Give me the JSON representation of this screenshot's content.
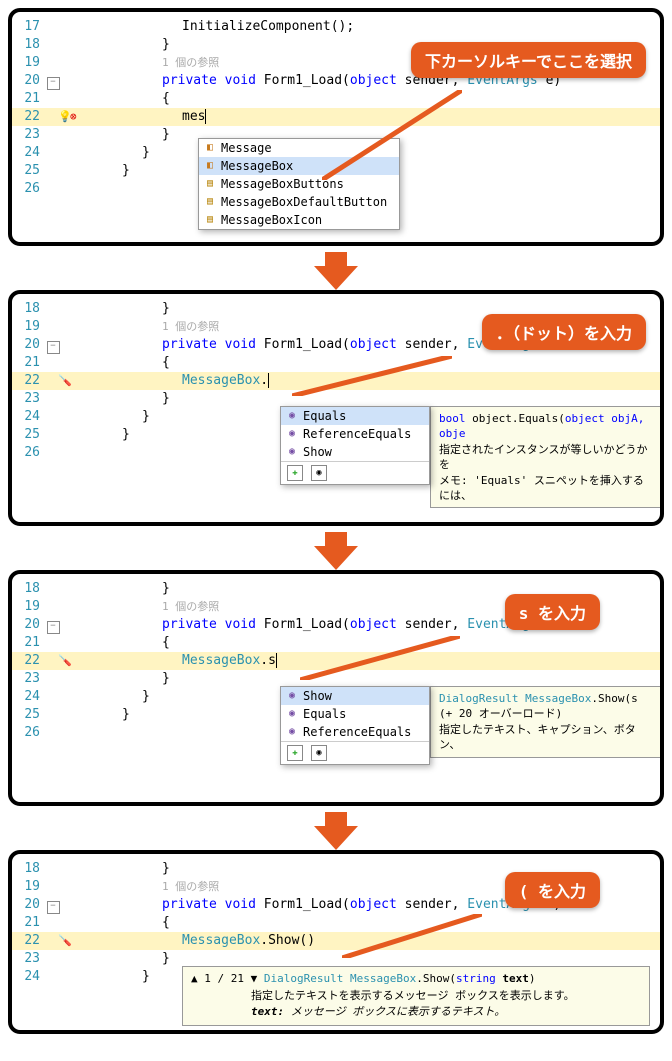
{
  "callouts": {
    "c1": "下カーソルキーでここを選択",
    "c2": "．（ドット）を入力",
    "c3": "s を入力",
    "c4": "( を入力"
  },
  "lines": [
    "17",
    "18",
    "19",
    "20",
    "21",
    "22",
    "23",
    "24",
    "25",
    "26"
  ],
  "ref_hint": "1 個の参照",
  "sig_private": "private",
  "sig_void": "void",
  "sig_name": "Form1_Load",
  "sig_obj": "object",
  "sig_sender": "sender",
  "sig_evargs": "EventArgs",
  "sig_e": "e",
  "brace_open": "{",
  "brace_close": "}",
  "init_call": "InitializeComponent();",
  "panel1": {
    "typed": "mes",
    "items": [
      "Message",
      "MessageBox",
      "MessageBoxButtons",
      "MessageBoxDefaultButton",
      "MessageBoxIcon"
    ]
  },
  "panel2": {
    "typed_class": "MessageBox",
    "typed_after": ".",
    "items": [
      "Equals",
      "ReferenceEquals",
      "Show"
    ],
    "tip_sig_ret": "bool",
    "tip_sig_cls": "object",
    "tip_sig_m": ".Equals(",
    "tip_sig_p": "object objA, obje",
    "tip_l2": "指定されたインスタンスが等しいかどうかを",
    "tip_l3": "メモ: 'Equals' スニペットを挿入するには、"
  },
  "panel3": {
    "typed_class": "MessageBox",
    "typed_after": ".s",
    "items": [
      "Show",
      "Equals",
      "ReferenceEquals"
    ],
    "tip_sig_ret": "DialogResult",
    "tip_sig_cls": "MessageBox",
    "tip_sig_m": ".Show(s",
    "tip_l2": "(+ 20 オーバーロード)",
    "tip_l3": "指定したテキスト、キャプション、ボタン、"
  },
  "panel4": {
    "typed_class": "MessageBox",
    "typed_mid": ".",
    "typed_method": "Show",
    "typed_after": "()",
    "nav_up": "▲",
    "nav_txt": "1 / 21",
    "nav_dn": "▼",
    "pi_ret": "DialogResult",
    "pi_cls": "MessageBox",
    "pi_m": ".Show(",
    "pi_ptype": "string",
    "pi_pname": "text",
    "pi_close": ")",
    "pi_l2": "指定したテキストを表示するメッセージ ボックスを表示します。",
    "pi_l3a": "text:",
    "pi_l3b": " メッセージ ボックスに表示するテキスト。"
  }
}
